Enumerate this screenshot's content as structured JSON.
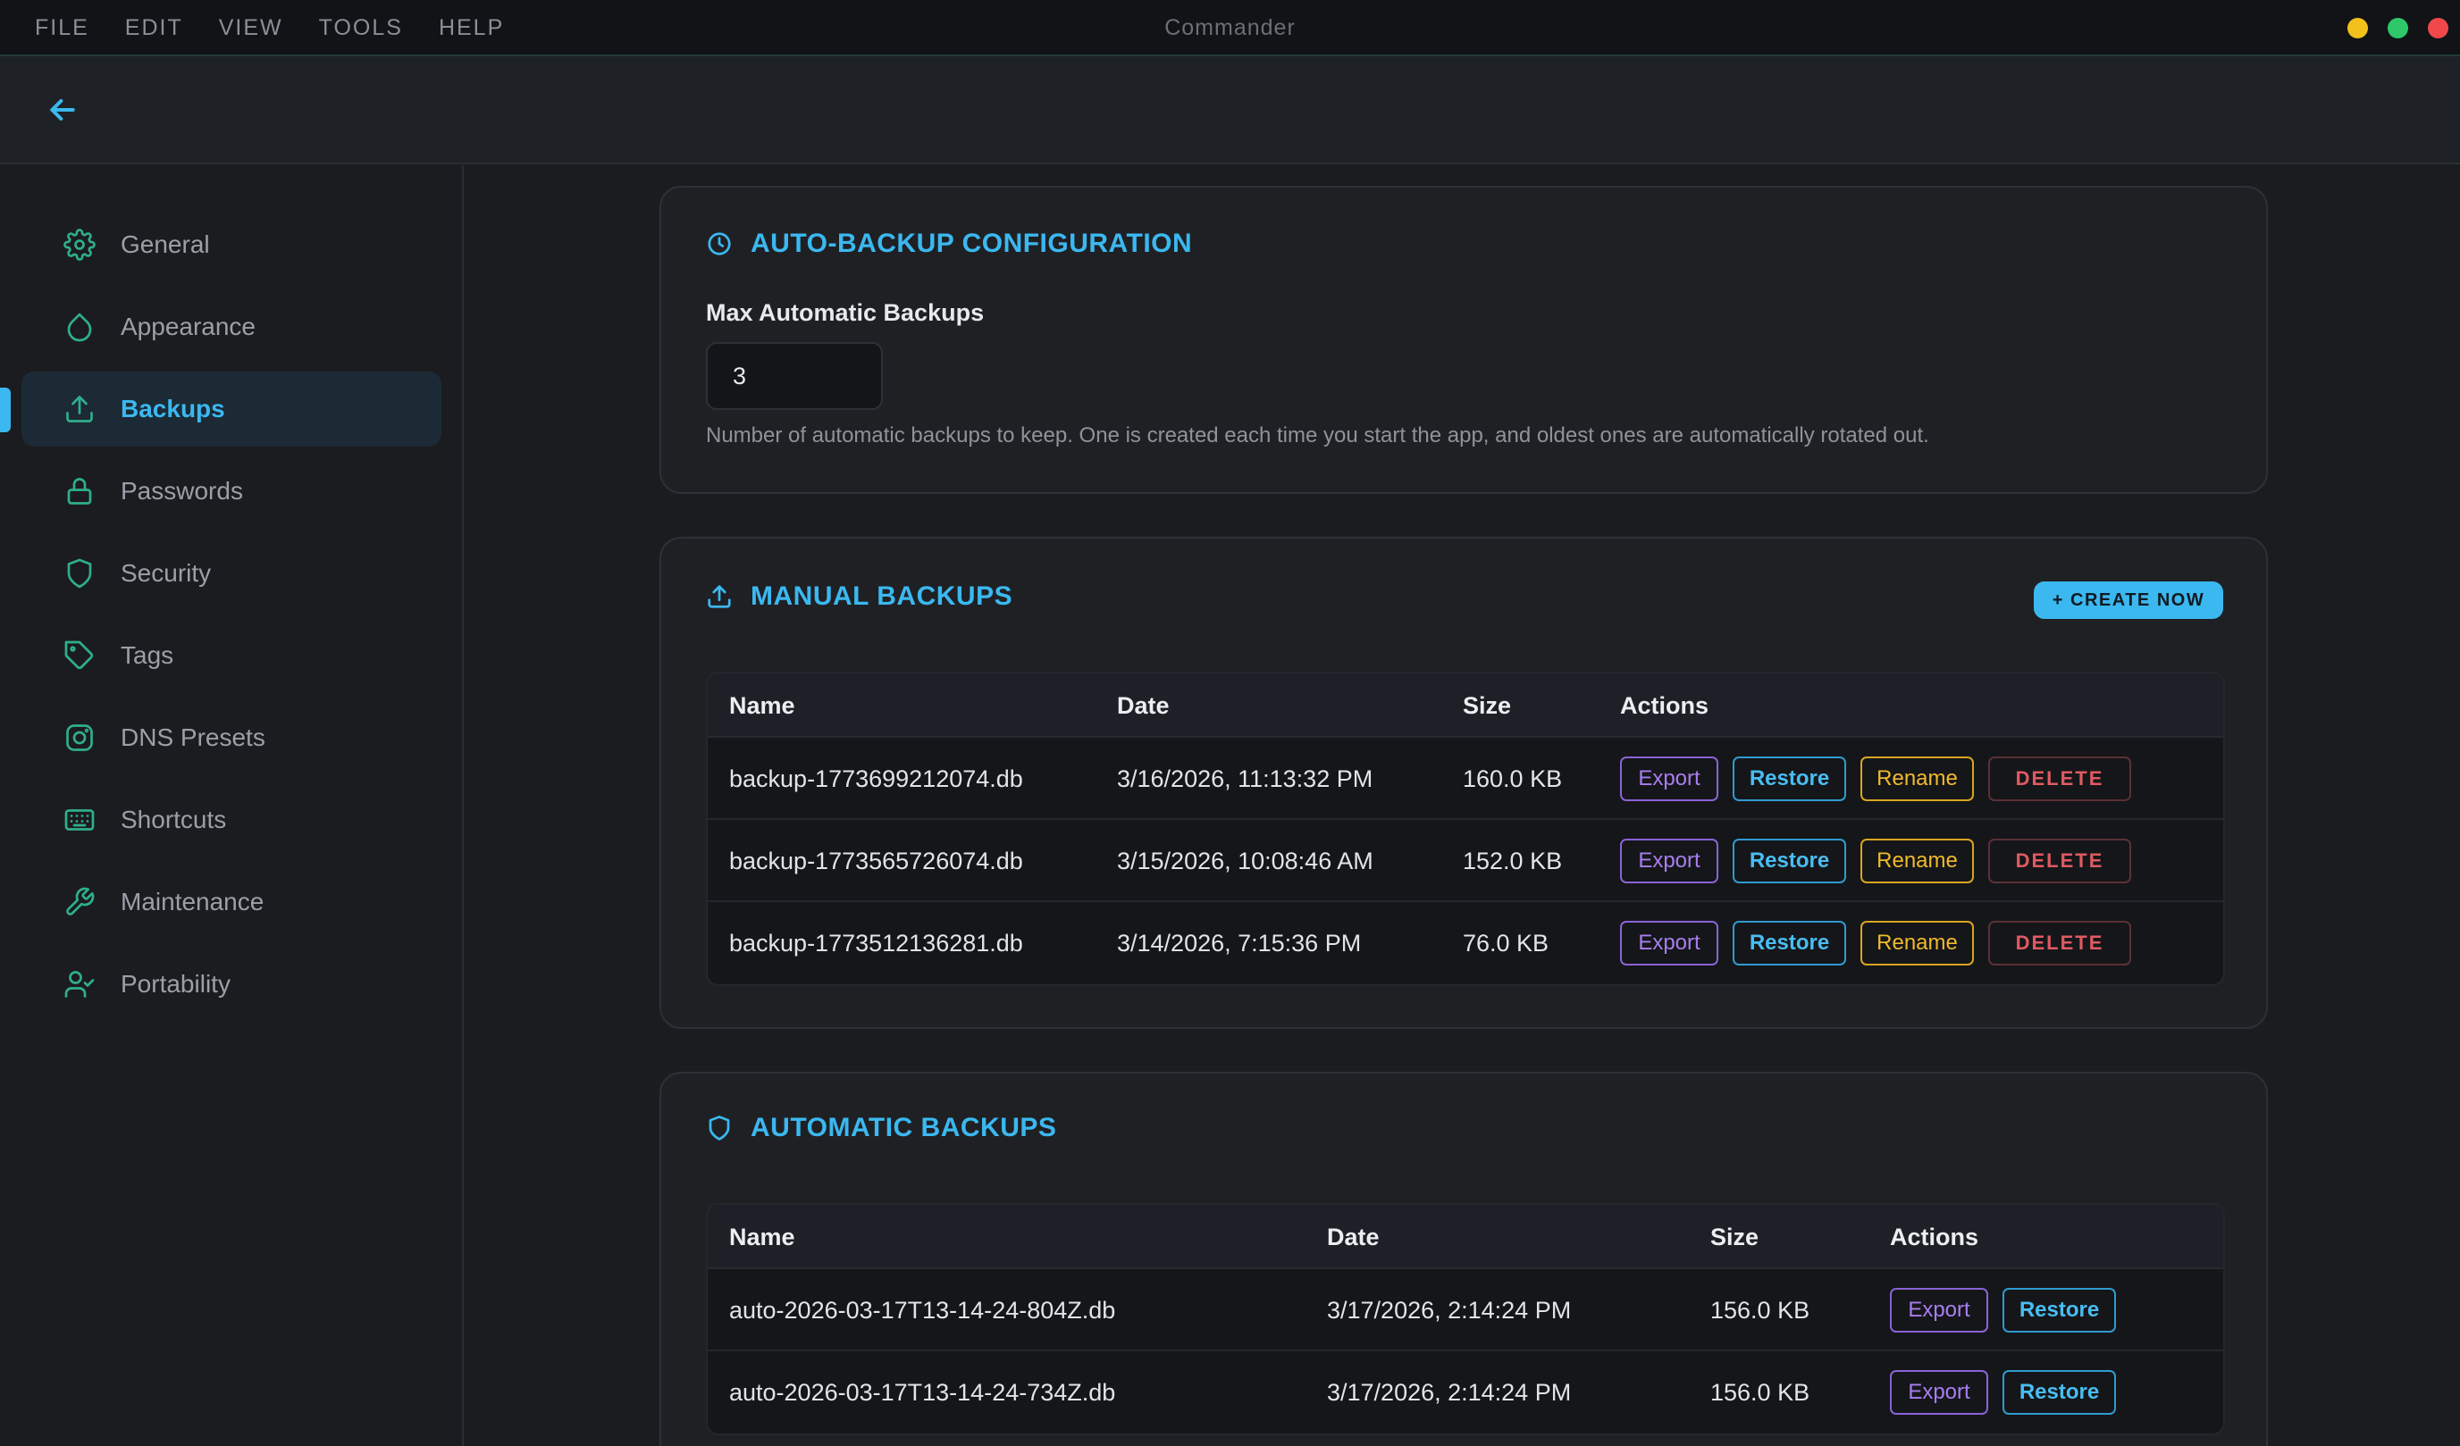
{
  "menu": [
    "FILE",
    "EDIT",
    "VIEW",
    "TOOLS",
    "HELP"
  ],
  "app_title": "Commander",
  "sidebar": {
    "items": [
      {
        "label": "General",
        "icon": "gear-icon"
      },
      {
        "label": "Appearance",
        "icon": "droplet-icon"
      },
      {
        "label": "Backups",
        "icon": "upload-icon",
        "active": true
      },
      {
        "label": "Passwords",
        "icon": "lock-icon"
      },
      {
        "label": "Security",
        "icon": "shield-icon"
      },
      {
        "label": "Tags",
        "icon": "tag-icon"
      },
      {
        "label": "DNS Presets",
        "icon": "dns-icon"
      },
      {
        "label": "Shortcuts",
        "icon": "keyboard-icon"
      },
      {
        "label": "Maintenance",
        "icon": "wrench-icon"
      },
      {
        "label": "Portability",
        "icon": "user-check-icon"
      }
    ]
  },
  "auto_config": {
    "title": "AUTO-BACKUP CONFIGURATION",
    "field_label": "Max Automatic Backups",
    "value": "3",
    "help": "Number of automatic backups to keep. One is created each time you start the app, and oldest ones are automatically rotated out."
  },
  "manual": {
    "title": "MANUAL BACKUPS",
    "create_label": "+ CREATE NOW",
    "columns": [
      "Name",
      "Date",
      "Size",
      "Actions"
    ],
    "rows": [
      {
        "name": "backup-1773699212074.db",
        "date": "3/16/2026, 11:13:32 PM",
        "size": "160.0 KB"
      },
      {
        "name": "backup-1773565726074.db",
        "date": "3/15/2026, 10:08:46 AM",
        "size": "152.0 KB"
      },
      {
        "name": "backup-1773512136281.db",
        "date": "3/14/2026, 7:15:36 PM",
        "size": "76.0 KB"
      }
    ],
    "actions": {
      "export": "Export",
      "restore": "Restore",
      "rename": "Rename",
      "delete": "DELETE"
    }
  },
  "automatic": {
    "title": "AUTOMATIC BACKUPS",
    "columns": [
      "Name",
      "Date",
      "Size",
      "Actions"
    ],
    "rows": [
      {
        "name": "auto-2026-03-17T13-14-24-804Z.db",
        "date": "3/17/2026, 2:14:24 PM",
        "size": "156.0 KB"
      },
      {
        "name": "auto-2026-03-17T13-14-24-734Z.db",
        "date": "3/17/2026, 2:14:24 PM",
        "size": "156.0 KB"
      }
    ],
    "actions": {
      "export": "Export",
      "restore": "Restore"
    }
  },
  "colors": {
    "accent": "#3bb8f0",
    "icon_green": "#2fae8c",
    "export": "#a77ef0",
    "rename": "#f0ba2e",
    "delete": "#e05a62"
  }
}
